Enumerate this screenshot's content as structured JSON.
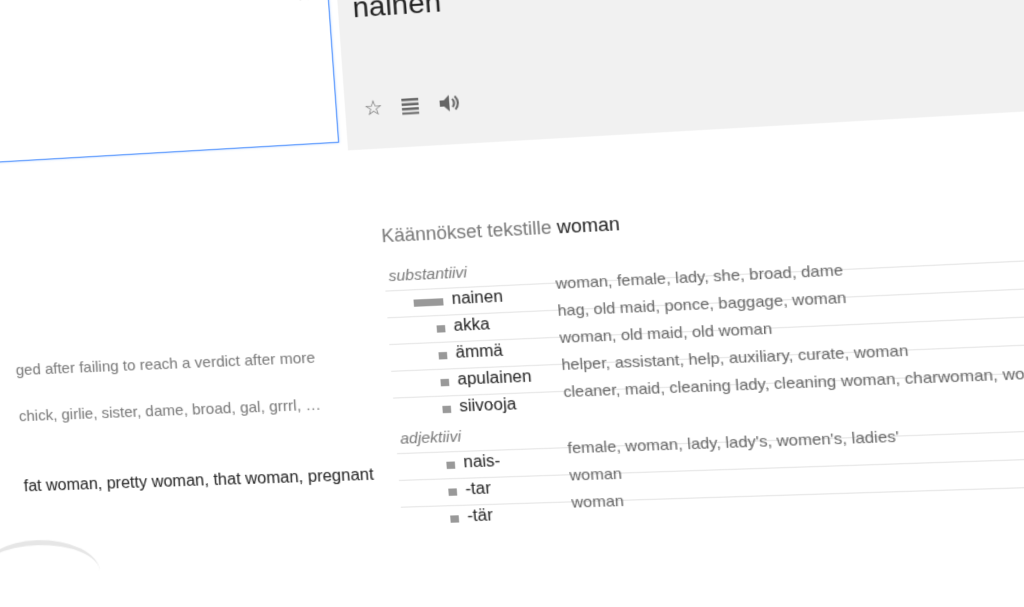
{
  "input": {
    "clear_label": "×"
  },
  "output": {
    "word": "nainen"
  },
  "tools": [
    {
      "name": "star-icon",
      "glyph": "☆"
    },
    {
      "name": "list-icon",
      "glyph": ""
    },
    {
      "name": "speaker-icon",
      "glyph": ""
    }
  ],
  "left_fragments": [
    "ged after failing to reach a verdict after more",
    "chick, girlie, sister, dame, broad, gal, grrrl, …",
    "fat woman, pretty woman, that woman, pregnant"
  ],
  "translations": {
    "title_prefix": "Käännökset tekstille",
    "title_word": "woman",
    "sections": [
      {
        "label": "substantiivi",
        "rows": [
          {
            "word": "nainen",
            "synonyms": "woman, female, lady, she, broad, dame",
            "bar": 1.0
          },
          {
            "word": "akka",
            "synonyms": "hag, old maid, ponce, baggage, woman",
            "bar": 0.3
          },
          {
            "word": "ämmä",
            "synonyms": "woman, old maid, old woman",
            "bar": 0.3
          },
          {
            "word": "apulainen",
            "synonyms": "helper, assistant, help, auxiliary, curate, woman",
            "bar": 0.3
          },
          {
            "word": "siivooja",
            "synonyms": "cleaner, maid, cleaning lady, cleaning woman, charwoman, woman",
            "bar": 0.3
          }
        ]
      },
      {
        "label": "adjektiivi",
        "rows": [
          {
            "word": "nais-",
            "synonyms": "female, woman, lady, lady's, women's, ladies'",
            "bar": 0.3
          },
          {
            "word": "-tar",
            "synonyms": "woman",
            "bar": 0.3
          },
          {
            "word": "-tär",
            "synonyms": "woman",
            "bar": 0.3
          }
        ]
      }
    ]
  }
}
